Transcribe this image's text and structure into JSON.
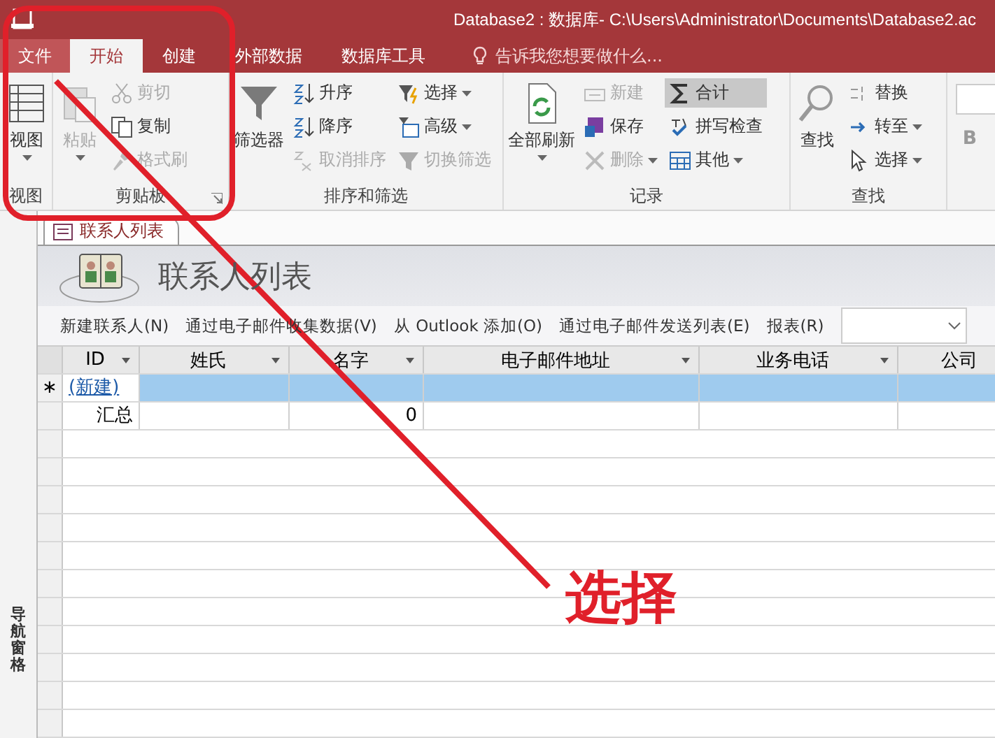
{
  "window": {
    "title": "Database2 : 数据库- C:\\Users\\Administrator\\Documents\\Database2.ac"
  },
  "tabs": [
    {
      "label": "文件",
      "kind": "file",
      "selected": false
    },
    {
      "label": "开始",
      "kind": "tab",
      "selected": true
    },
    {
      "label": "创建",
      "kind": "tab",
      "selected": false
    },
    {
      "label": "外部数据",
      "kind": "tab",
      "selected": false
    },
    {
      "label": "数据库工具",
      "kind": "tab",
      "selected": false
    }
  ],
  "tell_me": {
    "placeholder": "告诉我您想要做什么..."
  },
  "ribbon_groups": [
    {
      "name": "视图",
      "launcher": false,
      "large": {
        "label": "视图",
        "disabled": false,
        "dropdown": true
      }
    },
    {
      "name": "剪贴板",
      "launcher": true,
      "large": {
        "label": "粘贴",
        "disabled": true,
        "dropdown": true
      },
      "columns": [
        [
          {
            "label": "剪切",
            "disabled": true,
            "dropdown": false,
            "selected": false
          },
          {
            "label": "复制",
            "disabled": false,
            "dropdown": false,
            "selected": false
          },
          {
            "label": "格式刷",
            "disabled": true,
            "dropdown": false,
            "selected": false
          }
        ]
      ]
    },
    {
      "name": "排序和筛选",
      "launcher": false,
      "large": {
        "label": "筛选器",
        "disabled": false,
        "dropdown": false
      },
      "columns": [
        [
          {
            "label": "升序",
            "disabled": false,
            "dropdown": false,
            "selected": false
          },
          {
            "label": "降序",
            "disabled": false,
            "dropdown": false,
            "selected": false
          },
          {
            "label": "取消排序",
            "disabled": true,
            "dropdown": false,
            "selected": false
          }
        ],
        [
          {
            "label": "选择",
            "disabled": false,
            "dropdown": true,
            "selected": false
          },
          {
            "label": "高级",
            "disabled": false,
            "dropdown": true,
            "selected": false
          },
          {
            "label": "切换筛选",
            "disabled": true,
            "dropdown": false,
            "selected": false
          }
        ]
      ]
    },
    {
      "name": "记录",
      "launcher": false,
      "large": {
        "label": "全部刷新",
        "disabled": false,
        "dropdown": true
      },
      "columns": [
        [
          {
            "label": "新建",
            "disabled": true,
            "dropdown": false,
            "selected": false
          },
          {
            "label": "保存",
            "disabled": false,
            "dropdown": false,
            "selected": false
          },
          {
            "label": "删除",
            "disabled": true,
            "dropdown": true,
            "selected": false
          }
        ],
        [
          {
            "label": "合计",
            "disabled": false,
            "dropdown": false,
            "selected": true
          },
          {
            "label": "拼写检查",
            "disabled": false,
            "dropdown": false,
            "selected": false
          },
          {
            "label": "其他",
            "disabled": false,
            "dropdown": true,
            "selected": false
          }
        ]
      ]
    },
    {
      "name": "查找",
      "launcher": false,
      "large": {
        "label": "查找",
        "disabled": false,
        "dropdown": false
      },
      "columns": [
        [
          {
            "label": "替换",
            "disabled": false,
            "dropdown": false,
            "selected": false
          },
          {
            "label": "转至",
            "disabled": false,
            "dropdown": true,
            "selected": false
          },
          {
            "label": "选择",
            "disabled": false,
            "dropdown": true,
            "selected": false
          }
        ]
      ]
    }
  ],
  "font_group": {
    "bold_button": "B"
  },
  "document_tab": {
    "label": "联系人列表"
  },
  "form": {
    "title": "联系人列表",
    "commands": [
      "新建联系人(N)",
      "通过电子邮件收集数据(V)",
      "从 Outlook 添加(O)",
      "通过电子邮件发送列表(E)",
      "报表(R)"
    ]
  },
  "table": {
    "columns": [
      {
        "label": "ID",
        "dropdown": true
      },
      {
        "label": "姓氏",
        "dropdown": true
      },
      {
        "label": "名字",
        "dropdown": true
      },
      {
        "label": "电子邮件地址",
        "dropdown": true
      },
      {
        "label": "业务电话",
        "dropdown": true
      },
      {
        "label": "公司",
        "dropdown": false
      }
    ],
    "rows": [
      {
        "kind": "new",
        "selector": "∗",
        "selected": true,
        "cells": [
          "(新建)",
          "",
          "",
          "",
          "",
          ""
        ]
      },
      {
        "kind": "total",
        "selector": "",
        "selected": false,
        "cells": [
          "汇总",
          "",
          "0",
          "",
          "",
          ""
        ]
      }
    ]
  },
  "navigation_pane": {
    "label": "导航窗格"
  },
  "annotation": {
    "label": "选择"
  }
}
